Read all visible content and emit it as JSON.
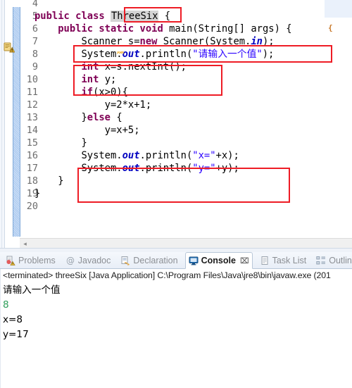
{
  "editor": {
    "first_visible_line": 4,
    "lines": [
      {
        "no": 4,
        "segments": []
      },
      {
        "no": 5,
        "segments": [
          {
            "t": "public class ",
            "c": "kw"
          },
          {
            "t": "ThreeSix",
            "c": "sel"
          },
          {
            "t": " {",
            "c": "plain"
          }
        ]
      },
      {
        "no": 6,
        "segments": [
          {
            "t": "    ",
            "c": "plain"
          },
          {
            "t": "public static void ",
            "c": "kw"
          },
          {
            "t": "main(String[] args) {",
            "c": "plain"
          }
        ]
      },
      {
        "no": 7,
        "segments": [
          {
            "t": "        Scanner s=",
            "c": "plain"
          },
          {
            "t": "new ",
            "c": "kw"
          },
          {
            "t": "Scanner(System.",
            "c": "plain"
          },
          {
            "t": "in",
            "c": "field"
          },
          {
            "t": ");",
            "c": "plain"
          }
        ]
      },
      {
        "no": 8,
        "segments": [
          {
            "t": "        System.",
            "c": "plain"
          },
          {
            "t": "out",
            "c": "field"
          },
          {
            "t": ".println(",
            "c": "plain"
          },
          {
            "t": "\"请输入一个值\"",
            "c": "str"
          },
          {
            "t": ");",
            "c": "plain"
          }
        ]
      },
      {
        "no": 9,
        "segments": [
          {
            "t": "        ",
            "c": "plain"
          },
          {
            "t": "int ",
            "c": "kw"
          },
          {
            "t": "x=s.nextInt();",
            "c": "plain"
          }
        ]
      },
      {
        "no": 10,
        "segments": [
          {
            "t": "        ",
            "c": "plain"
          },
          {
            "t": "int ",
            "c": "kw"
          },
          {
            "t": "y;",
            "c": "plain"
          }
        ]
      },
      {
        "no": 11,
        "segments": [
          {
            "t": "        ",
            "c": "plain"
          },
          {
            "t": "if",
            "c": "kw"
          },
          {
            "t": "(x>0){",
            "c": "plain"
          }
        ]
      },
      {
        "no": 12,
        "segments": [
          {
            "t": "            y=2*x+1;",
            "c": "plain"
          }
        ]
      },
      {
        "no": 13,
        "segments": [
          {
            "t": "        }",
            "c": "plain"
          },
          {
            "t": "else ",
            "c": "kw"
          },
          {
            "t": "{",
            "c": "plain"
          }
        ]
      },
      {
        "no": 14,
        "segments": [
          {
            "t": "            y=x+5;",
            "c": "plain"
          }
        ]
      },
      {
        "no": 15,
        "segments": [
          {
            "t": "        }",
            "c": "plain"
          }
        ]
      },
      {
        "no": 16,
        "segments": [
          {
            "t": "        System.",
            "c": "plain"
          },
          {
            "t": "out",
            "c": "field"
          },
          {
            "t": ".println(",
            "c": "plain"
          },
          {
            "t": "\"x=\"",
            "c": "str"
          },
          {
            "t": "+x);",
            "c": "plain"
          }
        ]
      },
      {
        "no": 17,
        "segments": [
          {
            "t": "        System.",
            "c": "plain"
          },
          {
            "t": "out",
            "c": "field"
          },
          {
            "t": ".println(",
            "c": "plain"
          },
          {
            "t": "\"y=\"",
            "c": "str"
          },
          {
            "t": "+y);",
            "c": "plain"
          }
        ]
      },
      {
        "no": 18,
        "segments": [
          {
            "t": "    }",
            "c": "plain"
          }
        ]
      },
      {
        "no": 19,
        "segments": [
          {
            "t": "}",
            "c": "plain"
          }
        ]
      },
      {
        "no": 20,
        "segments": []
      }
    ],
    "selected_token": "ThreeSix",
    "annotation_color": "#ee1c25",
    "warning_marker": "warning-icon",
    "scroll_left_arrow": "◂"
  },
  "console": {
    "tabs": [
      {
        "label": "Problems",
        "icon": "problems-icon",
        "active": false
      },
      {
        "label": "Javadoc",
        "icon": "javadoc-icon",
        "active": false
      },
      {
        "label": "Declaration",
        "icon": "declaration-icon",
        "active": false
      },
      {
        "label": "Console",
        "icon": "console-icon",
        "active": true,
        "close": "⌧"
      },
      {
        "label": "Task List",
        "icon": "tasklist-icon",
        "active": false
      },
      {
        "label": "Outline",
        "icon": "outline-icon",
        "active": false
      }
    ],
    "process_line": "<terminated> threeSix [Java Application] C:\\Program Files\\Java\\jre8\\bin\\javaw.exe (201",
    "output": [
      {
        "text": "请输入一个值",
        "color": "black"
      },
      {
        "text": "8",
        "color": "green"
      },
      {
        "text": "x=8",
        "color": "black"
      },
      {
        "text": "y=17",
        "color": "black"
      }
    ],
    "input_echo_color": "#2e9e5b"
  }
}
